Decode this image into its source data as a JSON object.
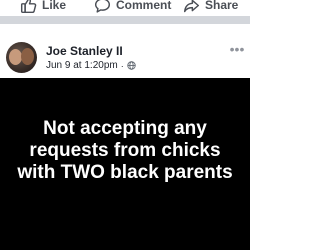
{
  "actions": {
    "like_label": "Like",
    "comment_label": "Comment",
    "share_label": "Share"
  },
  "icons": {
    "like": "thumbs-up-icon",
    "comment": "comment-bubble-icon",
    "share": "share-arrow-icon",
    "privacy": "globe-icon",
    "menu": "more-options-icon"
  },
  "post": {
    "author": "Joe Stanley II",
    "timestamp": "Jun 9 at 1:20pm",
    "separator": "·",
    "text": "Not accepting any requests from chicks with TWO black parents",
    "background_color": "#000000",
    "text_color": "#ffffff"
  },
  "colors": {
    "action_text": "#4b4f56",
    "divider": "#d3d6db"
  }
}
